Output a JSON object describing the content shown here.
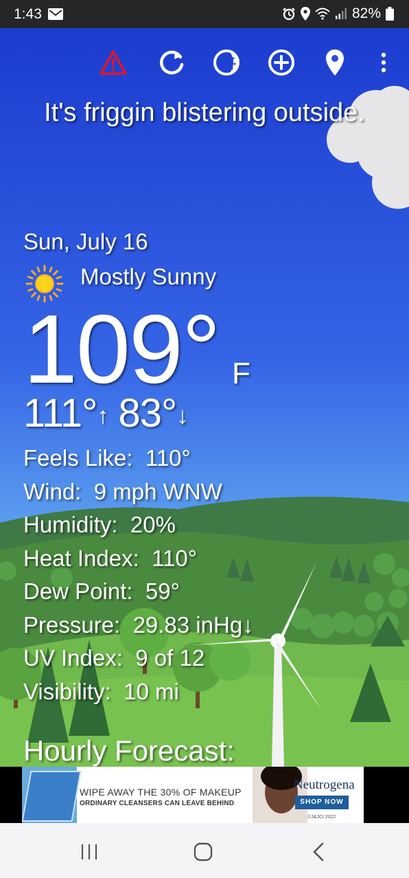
{
  "status_bar": {
    "time": "1:43",
    "battery": "82%",
    "icons": [
      "mail-icon",
      "alarm-icon",
      "location-icon",
      "wifi-icon",
      "signal-icon",
      "battery-icon"
    ]
  },
  "toolbar": {
    "icons": [
      "warning-icon",
      "refresh-icon",
      "theme-icon",
      "add-icon",
      "location-pin-icon",
      "more-icon"
    ],
    "warning_color": "#e0162b"
  },
  "headline": "It's friggin blistering outside.",
  "weather": {
    "date": "Sun, July 16",
    "condition": "Mostly Sunny",
    "condition_icon": "sun-icon",
    "temperature": "109°",
    "unit": "F",
    "high": "111°",
    "high_arrow": "↑",
    "low": "83°",
    "low_arrow": "↓"
  },
  "details": [
    {
      "label": "Feels Like:",
      "value": "110°"
    },
    {
      "label": "Wind:",
      "value": "9 mph WNW"
    },
    {
      "label": "Humidity:",
      "value": "20%"
    },
    {
      "label": "Heat Index:",
      "value": "110°"
    },
    {
      "label": "Dew Point:",
      "value": "59°"
    },
    {
      "label": "Pressure:",
      "value": "29.83 inHg↓"
    },
    {
      "label": "UV Index:",
      "value": "9 of 12"
    },
    {
      "label": "Visibility:",
      "value": "10 mi"
    }
  ],
  "hourly_heading": "Hourly Forecast:",
  "ad": {
    "line1": "WIPE AWAY THE 30% OF MAKEUP",
    "line2": "ORDINARY CLEANSERS CAN LEAVE BEHIND",
    "brand": "Neutrogena",
    "cta": "SHOP NOW",
    "copyright": "©J&JCI 2022"
  },
  "nav_bar": {
    "icons": [
      "recents-icon",
      "home-icon",
      "back-icon"
    ]
  }
}
